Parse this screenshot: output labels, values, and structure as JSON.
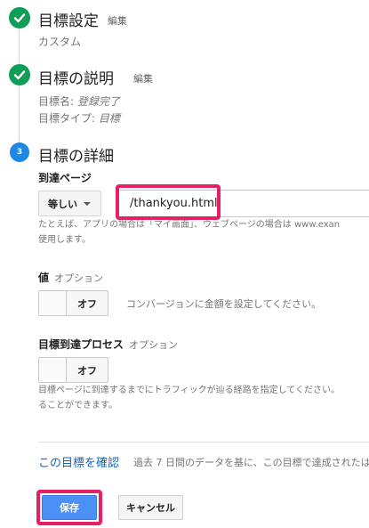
{
  "steps": [
    {
      "title": "目標設定",
      "edit": "編集",
      "lines": [
        "カスタム"
      ]
    },
    {
      "title": "目標の説明",
      "edit": "編集",
      "name_label": "目標名: ",
      "name_value": "登録完了",
      "type_label": "目標タイプ: ",
      "type_value": "目標"
    },
    {
      "number": "3",
      "title": "目標の詳細"
    }
  ],
  "destination": {
    "label": "到達ページ",
    "match_type": "等しい",
    "url_value": "/thankyou.html",
    "help_line1": "たとえば、アプリの場合は「マイ画面」、ウェブページの場合は www.exan",
    "help_line2": "使用します。"
  },
  "value": {
    "label": "値",
    "optional": "オプション",
    "toggle_state": "オフ",
    "description": "コンバージョンに金額を設定してください。"
  },
  "funnel": {
    "label": "目標到達プロセス",
    "optional": "オプション",
    "toggle_state": "オフ",
    "help_line1": "目標ページに到達するまでにトラフィックが辿る経路を指定してください。",
    "help_line2": "ることができます。"
  },
  "verify": {
    "link": "この目標を確認",
    "description": "過去 7 日間のデータを基に、この目標で達成されたは"
  },
  "actions": {
    "save": "保存",
    "cancel": "キャンセル"
  },
  "colors": {
    "check_green": "#0f9d58",
    "step_blue": "#1e88e5",
    "highlight": "#e91e63",
    "primary_button": "#4a90f5",
    "link": "#1565c0"
  }
}
